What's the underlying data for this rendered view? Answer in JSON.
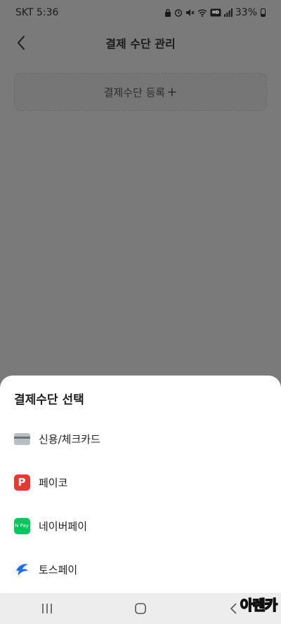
{
  "status_bar": {
    "carrier_time": "SKT 5:36",
    "battery": "33%",
    "icons": [
      "lock-icon",
      "alarm-icon",
      "mute-icon",
      "wifi-icon",
      "hd-voice-icon",
      "signal-icon",
      "battery-icon"
    ]
  },
  "header": {
    "title": "결제 수단 관리",
    "back_icon": "chevron-left-icon"
  },
  "register": {
    "label": "결제수단 등록",
    "plus": "+"
  },
  "sheet": {
    "title": "결제수단 선택",
    "options": [
      {
        "label": "신용/체크카드",
        "icon": "credit-card-icon"
      },
      {
        "label": "페이코",
        "icon": "payco-icon"
      },
      {
        "label": "네이버페이",
        "icon": "naver-pay-icon"
      },
      {
        "label": "토스페이",
        "icon": "toss-pay-icon"
      }
    ],
    "payco_icon_letter": "P",
    "npay_icon_text": "N Pay"
  },
  "navbar": {
    "buttons": [
      "recent-apps-icon",
      "home-icon",
      "back-icon"
    ]
  },
  "watermark": "아렌카",
  "colors": {
    "overlay": "#7a7a7a",
    "payco": "#e53935",
    "naver_pay": "#03c75a",
    "toss": "#1b6ef3"
  }
}
